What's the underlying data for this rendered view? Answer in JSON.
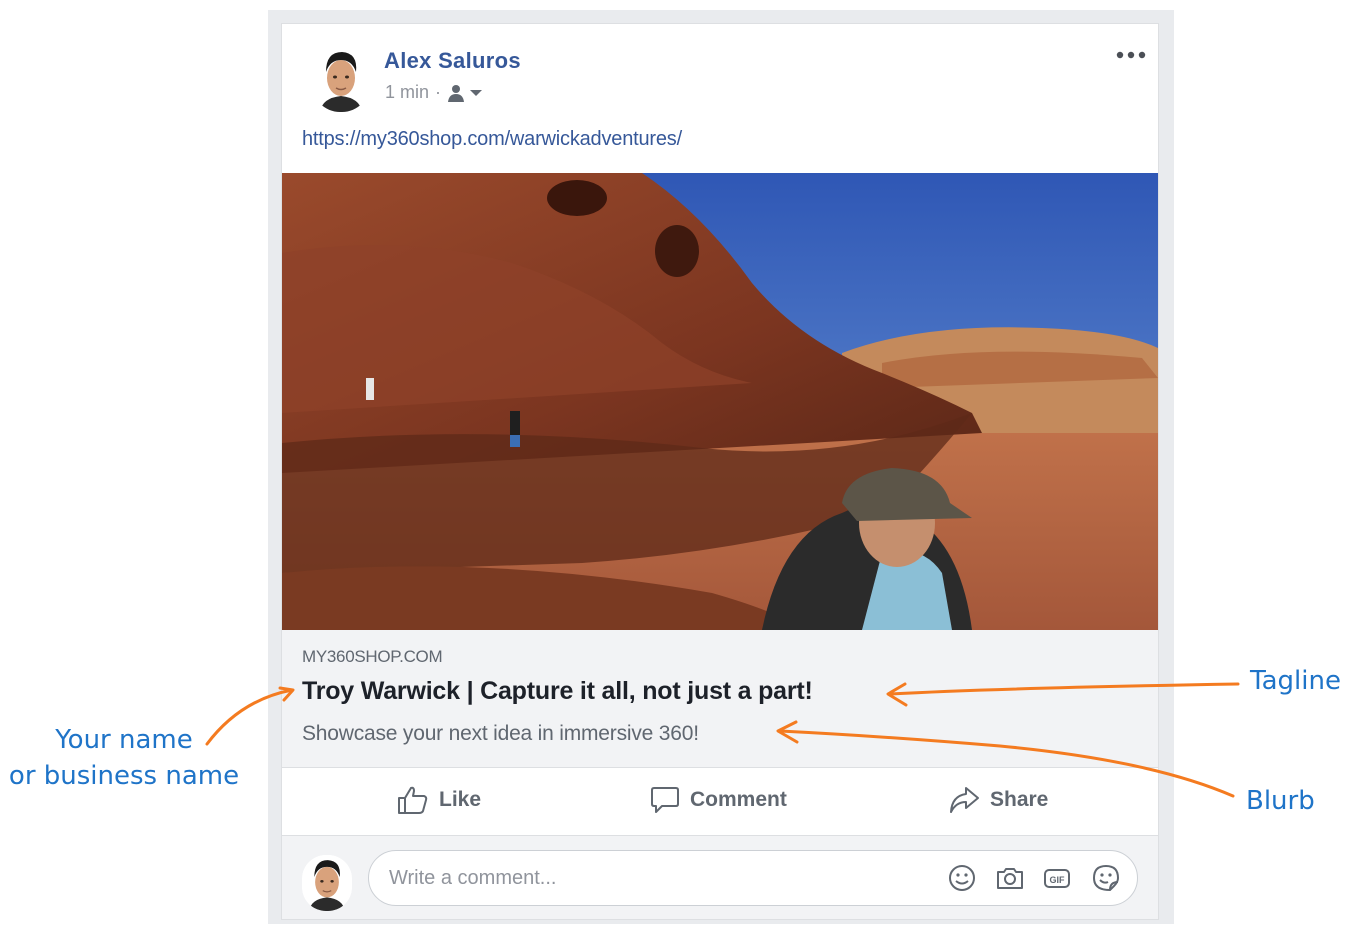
{
  "post": {
    "author_name": "Alex Saluros",
    "time": "1 min",
    "separator": "·",
    "privacy_icon": "friends-icon",
    "more_icon": "more-dots-icon",
    "link_text": "https://my360shop.com/warwickadventures/"
  },
  "preview": {
    "domain": "MY360SHOP.COM",
    "title": "Troy Warwick | Capture it all, not just a part!",
    "description": "Showcase your next idea in immersive 360!"
  },
  "actions": {
    "like": "Like",
    "comment": "Comment",
    "share": "Share"
  },
  "comment_box": {
    "placeholder": "Write a comment...",
    "icons": [
      "emoji-icon",
      "camera-icon",
      "gif-icon",
      "sticker-icon"
    ]
  },
  "annotations": {
    "name_line1": "Your name",
    "name_line2": "or business name",
    "tagline": "Tagline",
    "blurb": "Blurb"
  },
  "colors": {
    "link_blue": "#365899",
    "annotation_blue": "#1f74c8",
    "arrow_orange": "#f47b20"
  }
}
